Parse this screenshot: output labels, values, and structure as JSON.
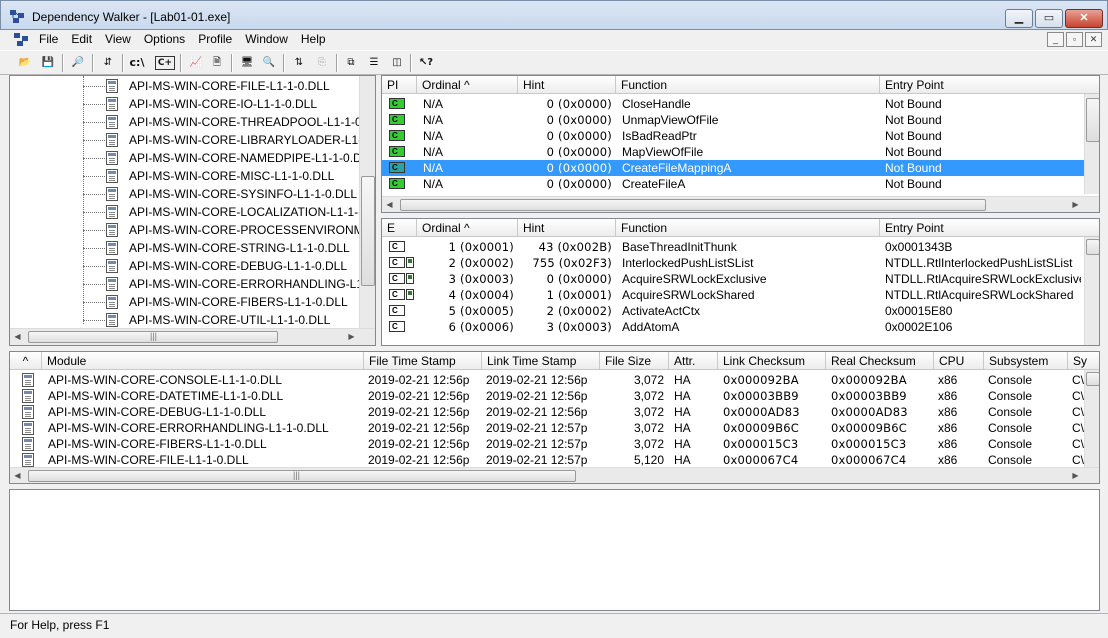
{
  "window": {
    "title": "Dependency Walker - [Lab01-01.exe]"
  },
  "menu": [
    "File",
    "Edit",
    "View",
    "Options",
    "Profile",
    "Window",
    "Help"
  ],
  "toolbar": {
    "path_label": "c:\\",
    "cpp_label": "C+"
  },
  "tree": {
    "items": [
      "API-MS-WIN-CORE-FILE-L1-1-0.DLL",
      "API-MS-WIN-CORE-IO-L1-1-0.DLL",
      "API-MS-WIN-CORE-THREADPOOL-L1-1-0.",
      "API-MS-WIN-CORE-LIBRARYLOADER-L1-1",
      "API-MS-WIN-CORE-NAMEDPIPE-L1-1-0.D",
      "API-MS-WIN-CORE-MISC-L1-1-0.DLL",
      "API-MS-WIN-CORE-SYSINFO-L1-1-0.DLL",
      "API-MS-WIN-CORE-LOCALIZATION-L1-1-(",
      "API-MS-WIN-CORE-PROCESSENVIRONME",
      "API-MS-WIN-CORE-STRING-L1-1-0.DLL",
      "API-MS-WIN-CORE-DEBUG-L1-1-0.DLL",
      "API-MS-WIN-CORE-ERRORHANDLING-L1-",
      "API-MS-WIN-CORE-FIBERS-L1-1-0.DLL",
      "API-MS-WIN-CORE-UTIL-L1-1-0.DLL"
    ]
  },
  "imports": {
    "columns": [
      "PI",
      "Ordinal ^",
      "Hint",
      "Function",
      "Entry Point"
    ],
    "rows": [
      {
        "icon": "C",
        "ordinal": "N/A",
        "hint": "0 (0x0000)",
        "function": "CloseHandle",
        "entry": "Not Bound"
      },
      {
        "icon": "C",
        "ordinal": "N/A",
        "hint": "0 (0x0000)",
        "function": "UnmapViewOfFile",
        "entry": "Not Bound"
      },
      {
        "icon": "C",
        "ordinal": "N/A",
        "hint": "0 (0x0000)",
        "function": "IsBadReadPtr",
        "entry": "Not Bound"
      },
      {
        "icon": "C",
        "ordinal": "N/A",
        "hint": "0 (0x0000)",
        "function": "MapViewOfFile",
        "entry": "Not Bound"
      },
      {
        "icon": "C",
        "ordinal": "N/A",
        "hint": "0 (0x0000)",
        "function": "CreateFileMappingA",
        "entry": "Not Bound"
      },
      {
        "icon": "C",
        "ordinal": "N/A",
        "hint": "0 (0x0000)",
        "function": "CreateFileA",
        "entry": "Not Bound"
      }
    ]
  },
  "exports": {
    "columns": [
      "E",
      "Ordinal ^",
      "Hint",
      "Function",
      "Entry Point"
    ],
    "rows": [
      {
        "icon": "C",
        "ordinal": "1 (0x0001)",
        "hint": "43 (0x002B)",
        "function": "BaseThreadInitThunk",
        "entry": "0x0001343B"
      },
      {
        "icon": "C",
        "ordinal": "2 (0x0002)",
        "hint": "755 (0x02F3)",
        "function": "InterlockedPushListSList",
        "entry": "NTDLL.RtlInterlockedPushListSList"
      },
      {
        "icon": "C",
        "ordinal": "3 (0x0003)",
        "hint": "0 (0x0000)",
        "function": "AcquireSRWLockExclusive",
        "entry": "NTDLL.RtlAcquireSRWLockExclusive"
      },
      {
        "icon": "C",
        "ordinal": "4 (0x0004)",
        "hint": "1 (0x0001)",
        "function": "AcquireSRWLockShared",
        "entry": "NTDLL.RtlAcquireSRWLockShared"
      },
      {
        "icon": "C",
        "ordinal": "5 (0x0005)",
        "hint": "2 (0x0002)",
        "function": "ActivateActCtx",
        "entry": "0x00015E80"
      },
      {
        "icon": "C",
        "ordinal": "6 (0x0006)",
        "hint": "3 (0x0003)",
        "function": "AddAtomA",
        "entry": "0x0002E106"
      }
    ]
  },
  "modules": {
    "columns": [
      "^",
      "Module",
      "File Time Stamp",
      "Link Time Stamp",
      "File Size",
      "Attr.",
      "Link Checksum",
      "Real Checksum",
      "CPU",
      "Subsystem",
      "Sy"
    ],
    "rows": [
      {
        "module": "API-MS-WIN-CORE-CONSOLE-L1-1-0.DLL",
        "file_ts": "2019-02-21 12:56p",
        "link_ts": "2019-02-21 12:56p",
        "size": "3,072",
        "attr": "HA",
        "link_ck": "0x000092BA",
        "real_ck": "0x000092BA",
        "cpu": "x86",
        "subsystem": "Console",
        "sy": "C\\"
      },
      {
        "module": "API-MS-WIN-CORE-DATETIME-L1-1-0.DLL",
        "file_ts": "2019-02-21 12:56p",
        "link_ts": "2019-02-21 12:56p",
        "size": "3,072",
        "attr": "HA",
        "link_ck": "0x00003BB9",
        "real_ck": "0x00003BB9",
        "cpu": "x86",
        "subsystem": "Console",
        "sy": "C\\"
      },
      {
        "module": "API-MS-WIN-CORE-DEBUG-L1-1-0.DLL",
        "file_ts": "2019-02-21 12:56p",
        "link_ts": "2019-02-21 12:56p",
        "size": "3,072",
        "attr": "HA",
        "link_ck": "0x0000AD83",
        "real_ck": "0x0000AD83",
        "cpu": "x86",
        "subsystem": "Console",
        "sy": "C\\"
      },
      {
        "module": "API-MS-WIN-CORE-ERRORHANDLING-L1-1-0.DLL",
        "file_ts": "2019-02-21 12:56p",
        "link_ts": "2019-02-21 12:57p",
        "size": "3,072",
        "attr": "HA",
        "link_ck": "0x00009B6C",
        "real_ck": "0x00009B6C",
        "cpu": "x86",
        "subsystem": "Console",
        "sy": "C\\"
      },
      {
        "module": "API-MS-WIN-CORE-FIBERS-L1-1-0.DLL",
        "file_ts": "2019-02-21 12:56p",
        "link_ts": "2019-02-21 12:57p",
        "size": "3,072",
        "attr": "HA",
        "link_ck": "0x000015C3",
        "real_ck": "0x000015C3",
        "cpu": "x86",
        "subsystem": "Console",
        "sy": "C\\"
      },
      {
        "module": "API-MS-WIN-CORE-FILE-L1-1-0.DLL",
        "file_ts": "2019-02-21 12:56p",
        "link_ts": "2019-02-21 12:57p",
        "size": "5,120",
        "attr": "HA",
        "link_ck": "0x000067C4",
        "real_ck": "0x000067C4",
        "cpu": "x86",
        "subsystem": "Console",
        "sy": "C\\"
      }
    ]
  },
  "status": {
    "text": "For Help, press F1"
  },
  "icons": {
    "open": "open-folder-icon",
    "save": "save-icon",
    "find": "find-icon",
    "colors": {
      "selection": "#3399ff",
      "import_icon": "#33cc33"
    }
  }
}
